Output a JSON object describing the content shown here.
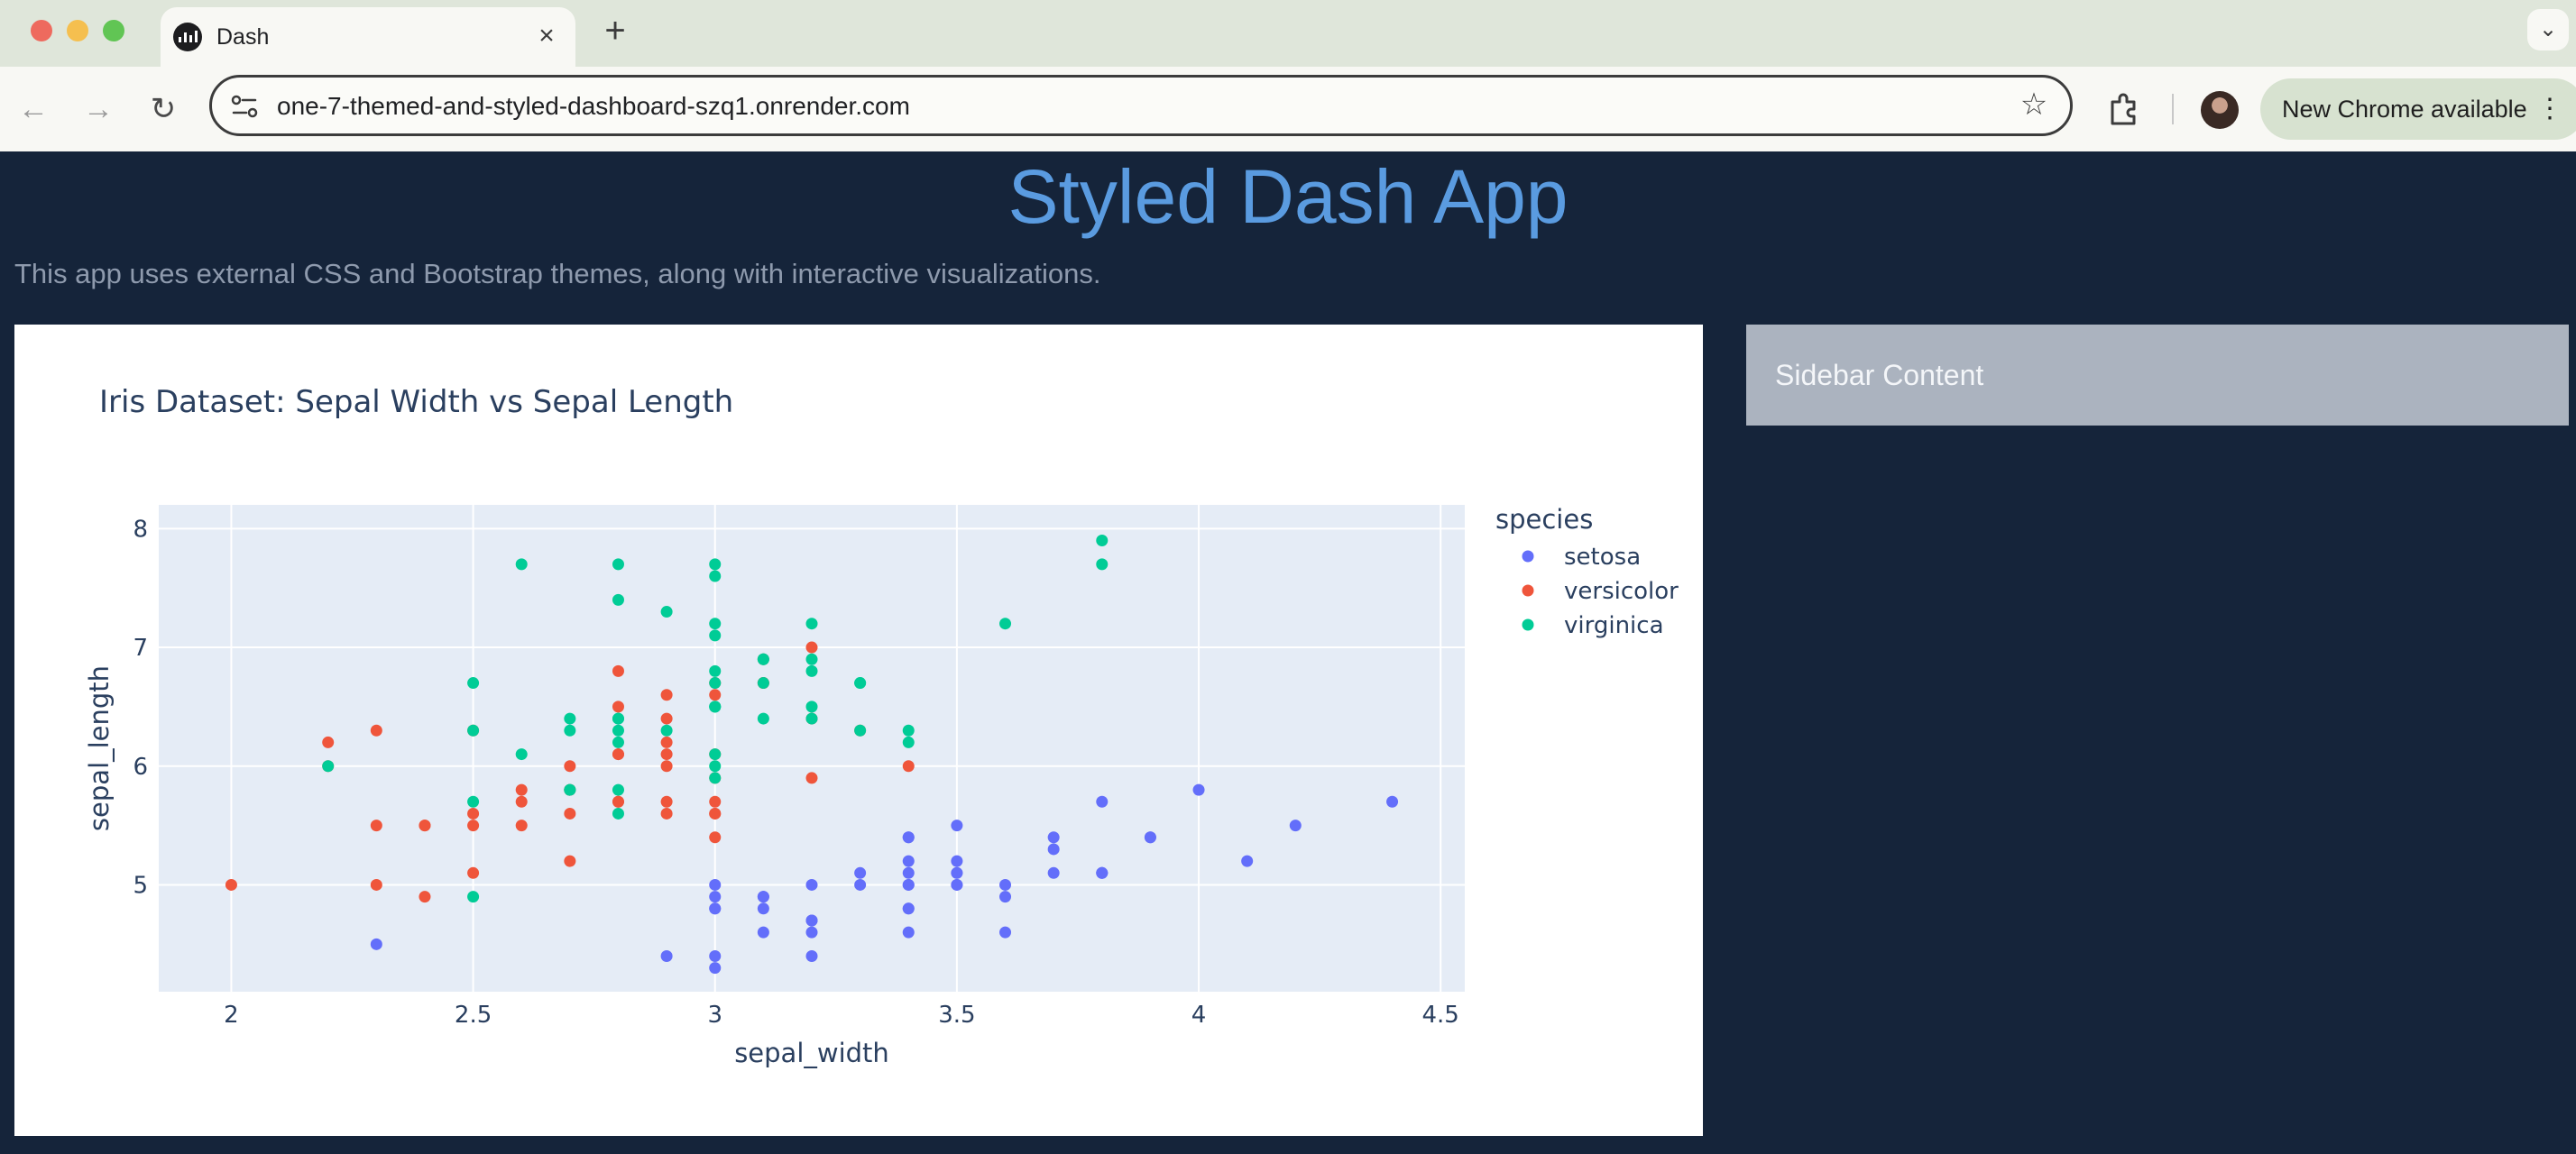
{
  "browser": {
    "tab_title": "Dash",
    "url": "one-7-themed-and-styled-dashboard-szq1.onrender.com",
    "update_label": "New Chrome available",
    "icons": [
      "back-icon",
      "forward-icon",
      "reload-icon",
      "site-info-icon",
      "star-icon",
      "extensions-icon",
      "kebab-icon",
      "close-icon",
      "plus-icon",
      "chevron-down-icon"
    ]
  },
  "app": {
    "title": "Styled Dash App",
    "subtitle": "This app uses external CSS and Bootstrap themes, along with interactive visualizations.",
    "sidebar_label": "Sidebar Content",
    "colors": {
      "background": "#15243a",
      "title": "#5a9be0",
      "sidebar": "#abb3bf",
      "plot_bg": "#e5ecf6"
    }
  },
  "chart_data": {
    "type": "scatter",
    "title": "Iris Dataset: Sepal Width vs Sepal Length",
    "xlabel": "sepal_width",
    "ylabel": "sepal_length",
    "xlim": [
      1.85,
      4.55
    ],
    "ylim": [
      4.1,
      8.2
    ],
    "xticks": [
      2,
      2.5,
      3,
      3.5,
      4,
      4.5
    ],
    "yticks": [
      5,
      6,
      7,
      8
    ],
    "grid": true,
    "legend_title": "species",
    "legend_position": "right",
    "series": [
      {
        "name": "setosa",
        "color": "#636efa",
        "points": [
          [
            3.5,
            5.1
          ],
          [
            3.0,
            4.9
          ],
          [
            3.2,
            4.7
          ],
          [
            3.1,
            4.6
          ],
          [
            3.6,
            5.0
          ],
          [
            3.9,
            5.4
          ],
          [
            3.4,
            4.6
          ],
          [
            3.4,
            5.0
          ],
          [
            2.9,
            4.4
          ],
          [
            3.1,
            4.9
          ],
          [
            3.7,
            5.4
          ],
          [
            3.4,
            4.8
          ],
          [
            3.0,
            4.8
          ],
          [
            3.0,
            4.3
          ],
          [
            4.0,
            5.8
          ],
          [
            4.4,
            5.7
          ],
          [
            3.9,
            5.4
          ],
          [
            3.5,
            5.1
          ],
          [
            3.8,
            5.7
          ],
          [
            3.8,
            5.1
          ],
          [
            3.4,
            5.4
          ],
          [
            3.7,
            5.1
          ],
          [
            3.6,
            4.6
          ],
          [
            3.3,
            5.1
          ],
          [
            3.4,
            4.8
          ],
          [
            3.0,
            5.0
          ],
          [
            3.4,
            5.0
          ],
          [
            3.5,
            5.2
          ],
          [
            3.4,
            5.2
          ],
          [
            3.2,
            4.7
          ],
          [
            3.1,
            4.8
          ],
          [
            3.4,
            5.4
          ],
          [
            4.1,
            5.2
          ],
          [
            4.2,
            5.5
          ],
          [
            3.1,
            4.9
          ],
          [
            3.2,
            5.0
          ],
          [
            3.5,
            5.5
          ],
          [
            3.6,
            4.9
          ],
          [
            3.0,
            4.4
          ],
          [
            3.4,
            5.1
          ],
          [
            3.5,
            5.0
          ],
          [
            2.3,
            4.5
          ],
          [
            3.2,
            4.4
          ],
          [
            3.5,
            5.0
          ],
          [
            3.8,
            5.1
          ],
          [
            3.0,
            4.8
          ],
          [
            3.8,
            5.1
          ],
          [
            3.2,
            4.6
          ],
          [
            3.7,
            5.3
          ],
          [
            3.3,
            5.0
          ]
        ]
      },
      {
        "name": "versicolor",
        "color": "#ef553b",
        "points": [
          [
            3.2,
            7.0
          ],
          [
            3.2,
            6.4
          ],
          [
            3.1,
            6.9
          ],
          [
            2.3,
            5.5
          ],
          [
            2.8,
            6.5
          ],
          [
            2.8,
            5.7
          ],
          [
            3.3,
            6.3
          ],
          [
            2.4,
            4.9
          ],
          [
            2.9,
            6.6
          ],
          [
            2.7,
            5.2
          ],
          [
            2.0,
            5.0
          ],
          [
            3.0,
            5.9
          ],
          [
            2.2,
            6.0
          ],
          [
            2.9,
            6.1
          ],
          [
            2.9,
            5.6
          ],
          [
            3.1,
            6.7
          ],
          [
            3.0,
            5.6
          ],
          [
            2.7,
            5.8
          ],
          [
            2.2,
            6.2
          ],
          [
            2.5,
            5.6
          ],
          [
            3.2,
            5.9
          ],
          [
            2.8,
            6.1
          ],
          [
            2.5,
            6.3
          ],
          [
            2.8,
            6.1
          ],
          [
            2.9,
            6.4
          ],
          [
            3.0,
            6.6
          ],
          [
            2.8,
            6.8
          ],
          [
            3.0,
            6.7
          ],
          [
            2.9,
            6.0
          ],
          [
            2.6,
            5.7
          ],
          [
            2.4,
            5.5
          ],
          [
            2.4,
            5.5
          ],
          [
            2.7,
            5.8
          ],
          [
            2.7,
            6.0
          ],
          [
            3.0,
            5.4
          ],
          [
            3.4,
            6.0
          ],
          [
            3.1,
            6.7
          ],
          [
            2.3,
            6.3
          ],
          [
            3.0,
            5.6
          ],
          [
            2.5,
            5.5
          ],
          [
            2.6,
            5.5
          ],
          [
            3.0,
            6.1
          ],
          [
            2.6,
            5.8
          ],
          [
            2.3,
            5.0
          ],
          [
            2.7,
            5.6
          ],
          [
            3.0,
            5.7
          ],
          [
            2.9,
            5.7
          ],
          [
            2.9,
            6.2
          ],
          [
            2.5,
            5.1
          ],
          [
            2.8,
            5.7
          ]
        ]
      },
      {
        "name": "virginica",
        "color": "#00cc96",
        "points": [
          [
            3.3,
            6.3
          ],
          [
            2.7,
            5.8
          ],
          [
            3.0,
            7.1
          ],
          [
            2.9,
            6.3
          ],
          [
            3.0,
            6.5
          ],
          [
            3.0,
            7.6
          ],
          [
            2.5,
            4.9
          ],
          [
            2.9,
            7.3
          ],
          [
            2.5,
            6.7
          ],
          [
            3.6,
            7.2
          ],
          [
            3.2,
            6.5
          ],
          [
            2.7,
            6.4
          ],
          [
            3.0,
            6.8
          ],
          [
            2.5,
            5.7
          ],
          [
            2.8,
            5.8
          ],
          [
            3.2,
            6.4
          ],
          [
            3.0,
            6.5
          ],
          [
            3.8,
            7.7
          ],
          [
            2.6,
            7.7
          ],
          [
            2.2,
            6.0
          ],
          [
            3.2,
            6.9
          ],
          [
            2.8,
            5.6
          ],
          [
            2.8,
            7.7
          ],
          [
            2.7,
            6.3
          ],
          [
            3.3,
            6.7
          ],
          [
            3.2,
            7.2
          ],
          [
            2.8,
            6.2
          ],
          [
            3.0,
            6.1
          ],
          [
            2.8,
            6.4
          ],
          [
            3.0,
            7.2
          ],
          [
            2.8,
            7.4
          ],
          [
            3.8,
            7.9
          ],
          [
            2.8,
            6.4
          ],
          [
            2.8,
            6.3
          ],
          [
            2.6,
            6.1
          ],
          [
            3.0,
            7.7
          ],
          [
            3.4,
            6.3
          ],
          [
            3.1,
            6.4
          ],
          [
            3.0,
            6.0
          ],
          [
            3.1,
            6.9
          ],
          [
            3.1,
            6.7
          ],
          [
            3.1,
            6.9
          ],
          [
            2.7,
            5.8
          ],
          [
            3.2,
            6.8
          ],
          [
            3.3,
            6.7
          ],
          [
            3.0,
            6.7
          ],
          [
            2.5,
            6.3
          ],
          [
            3.0,
            6.5
          ],
          [
            3.4,
            6.2
          ],
          [
            3.0,
            5.9
          ]
        ]
      }
    ]
  }
}
